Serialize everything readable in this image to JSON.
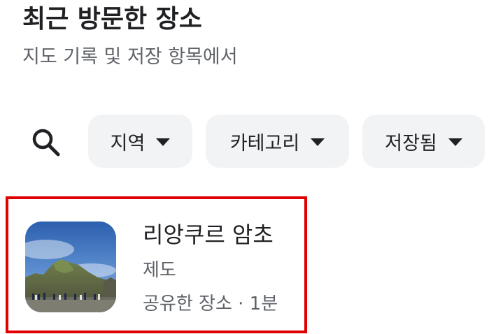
{
  "header": {
    "title": "최근 방문한 장소",
    "subtitle": "지도 기록 및 저장 항목에서"
  },
  "filters": {
    "search_icon": "search-icon",
    "chips": [
      {
        "label": "지역",
        "icon": "dropdown-arrow-icon"
      },
      {
        "label": "카테고리",
        "icon": "dropdown-arrow-icon"
      },
      {
        "label": "저장됨",
        "icon": "dropdown-arrow-icon"
      }
    ]
  },
  "results": [
    {
      "name": "리앙쿠르 암초",
      "region": "제도",
      "source": "공유한 장소",
      "separator": "·",
      "time": "1분",
      "thumbnail": "rocky-islet-photo"
    }
  ],
  "colors": {
    "highlight_border": "#e00000",
    "chip_background": "#f1f3f4",
    "secondary_text": "#5f6368",
    "primary_text": "#202124"
  }
}
